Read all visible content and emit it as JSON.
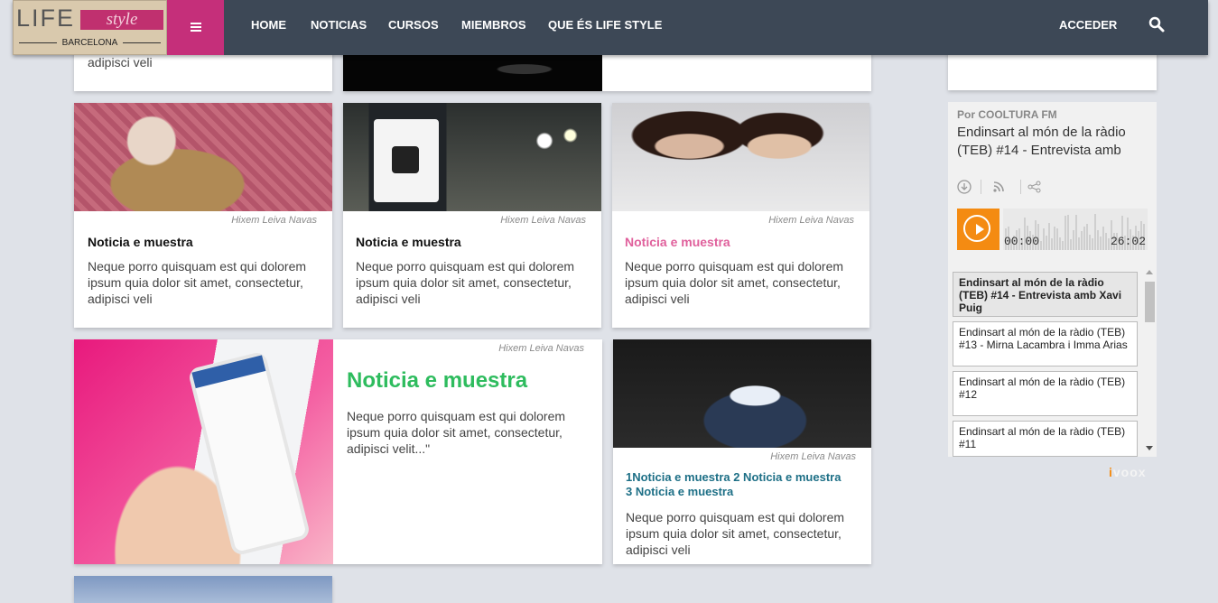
{
  "header": {
    "logo": {
      "life": "LIFE",
      "style": "style",
      "city": "BARCELONA"
    },
    "nav": [
      "HOME",
      "NOTICIAS",
      "CURSOS",
      "MIEMBROS",
      "QUE ÉS LIFE STYLE"
    ],
    "login": "ACCEDER"
  },
  "top_row": {
    "card1_body_tail": "adipisci veli"
  },
  "cards": [
    {
      "author": "Hixem Leiva Navas",
      "title": "Noticia e muestra",
      "title_color": "#111111",
      "body": "Neque porro quisquam est qui dolorem ipsum quia dolor sit amet, consectetur, adipisci veli"
    },
    {
      "author": "Hixem Leiva Navas",
      "title": "Noticia e muestra",
      "title_color": "#111111",
      "body": "Neque porro quisquam est qui dolorem ipsum quia dolor sit amet, consectetur, adipisci veli"
    },
    {
      "author": "Hixem Leiva Navas",
      "title": "Noticia e muestra",
      "title_color": "#e0609c",
      "body": "Neque porro quisquam est qui dolorem ipsum quia dolor sit amet, consectetur, adipisci veli"
    }
  ],
  "feature": {
    "author": "Hixem Leiva Navas",
    "title": "Noticia e muestra",
    "title_color": "#2ebc5e",
    "body": "Neque porro quisquam est qui dolorem ipsum quia dolor sit amet, consectetur, adipisci velit...\""
  },
  "cat_card": {
    "author": "Hixem Leiva Navas",
    "title": "1Noticia e muestra 2 Noticia e muestra 3 Noticia e muestra",
    "title_color": "#1d6f86",
    "body": "Neque porro quisquam est qui dolorem ipsum quia dolor sit amet, consectetur, adipisci veli"
  },
  "podcast": {
    "by": "Por COOLTURA FM",
    "title": "Endinsart al món de la ràdio (TEB) #14 - Entrevista amb",
    "time_start": "00:00",
    "time_end": "26:02",
    "accent": "#f48b12",
    "episodes": [
      "Endinsart al món de la ràdio (TEB) #14 - Entrevista amb Xavi Puig",
      "Endinsart al món de la ràdio (TEB) #13 - Mirna Lacambra i Imma Arias",
      "Endinsart al món de la ràdio (TEB) #12",
      "Endinsart al món de la ràdio (TEB) #11"
    ],
    "brand": "ivoox"
  }
}
